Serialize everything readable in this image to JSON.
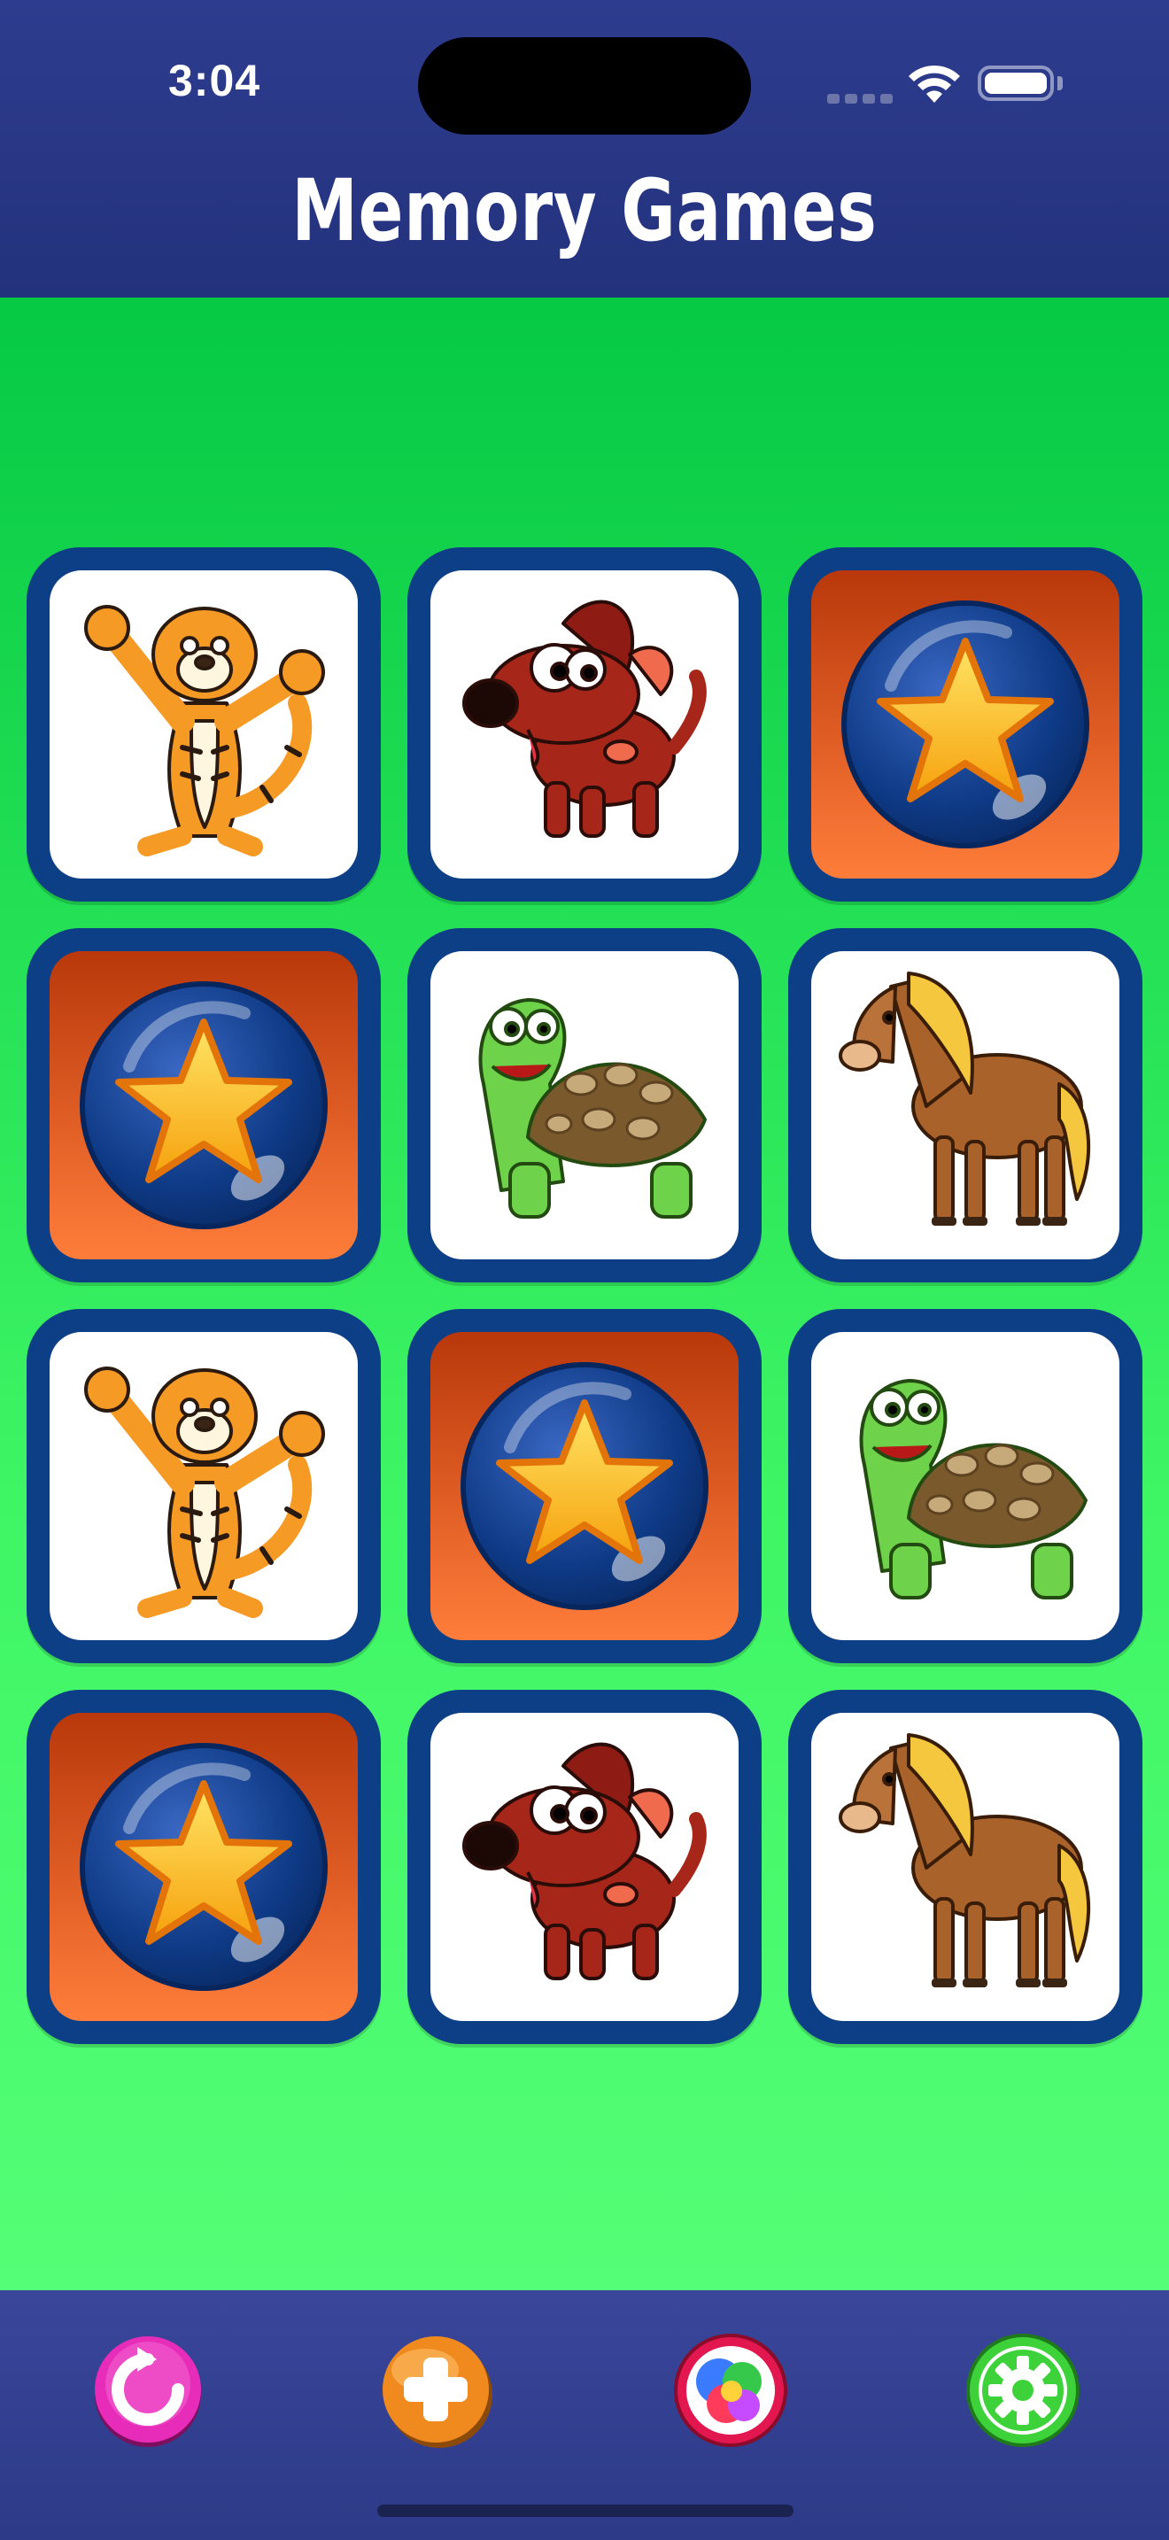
{
  "status_bar": {
    "time": "3:04"
  },
  "header": {
    "title": "Memory Games"
  },
  "board": {
    "rows": 4,
    "columns": 3,
    "cards": [
      {
        "face": "tiger",
        "revealed": true
      },
      {
        "face": "dog",
        "revealed": true
      },
      {
        "face": "star",
        "revealed": false
      },
      {
        "face": "star",
        "revealed": false
      },
      {
        "face": "turtle",
        "revealed": true
      },
      {
        "face": "horse",
        "revealed": true
      },
      {
        "face": "tiger",
        "revealed": true
      },
      {
        "face": "star",
        "revealed": false
      },
      {
        "face": "turtle",
        "revealed": true
      },
      {
        "face": "star",
        "revealed": false
      },
      {
        "face": "dog",
        "revealed": true
      },
      {
        "face": "horse",
        "revealed": true
      }
    ]
  },
  "toolbar": {
    "buttons": [
      {
        "name": "restart",
        "icon": "restart-icon",
        "color": "#e62cb8"
      },
      {
        "name": "add",
        "icon": "plus-icon",
        "color": "#f08a1e"
      },
      {
        "name": "theme",
        "icon": "color-balls-icon",
        "color": "#e3174f"
      },
      {
        "name": "settings",
        "icon": "gear-icon",
        "color": "#3ed23a"
      }
    ]
  },
  "colors": {
    "header_bg": "#2e3c8f",
    "board_top": "#06c944",
    "board_bottom": "#54fe76",
    "card_frame": "#0d3f86",
    "card_back_top": "#b9380b",
    "card_back_bottom": "#ff7d3a"
  }
}
